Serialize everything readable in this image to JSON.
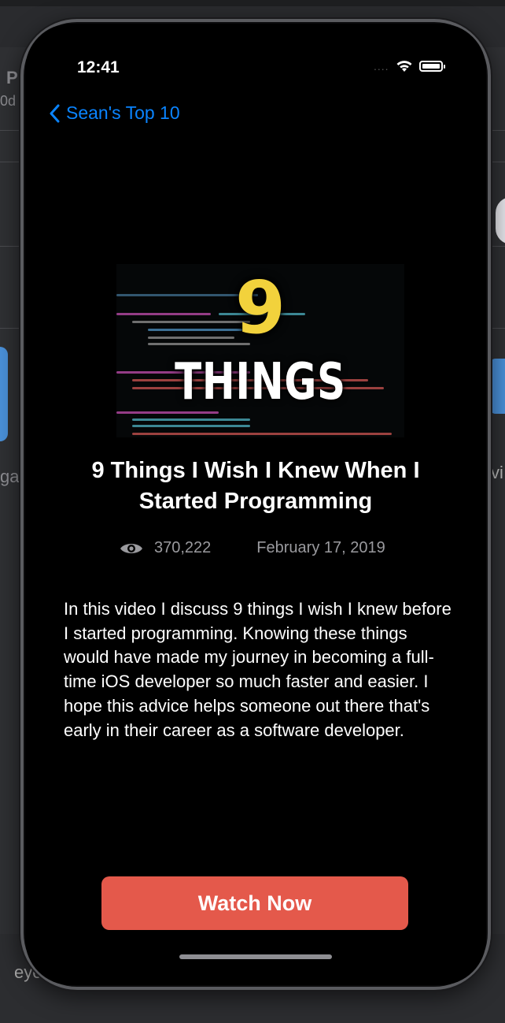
{
  "background": {
    "left_text_top": "P",
    "left_text_sub": "0d",
    "left_text_mid": "ga",
    "right_text_mid": "vi",
    "bottom_text": "eye"
  },
  "status_bar": {
    "time": "12:41",
    "signal": "....",
    "wifi_icon": "wifi-icon",
    "battery_icon": "battery-icon"
  },
  "nav": {
    "back_label": "Sean's Top 10",
    "back_icon": "chevron-left-icon",
    "accent_color": "#0a84ff"
  },
  "video": {
    "thumbnail": {
      "number": "9",
      "word": "THINGS"
    },
    "title": "9 Things I Wish I Knew When I Started Programming",
    "views": "370,222",
    "views_icon": "eye-icon",
    "date": "February 17, 2019",
    "description": "In this video I discuss 9 things I wish I knew before I started programming. Knowing these things would have made my journey in becoming a full-time iOS developer so much faster and easier. I hope this advice helps someone out there that's early in their career as a software developer."
  },
  "actions": {
    "watch_label": "Watch Now",
    "watch_color": "#e4594b"
  }
}
